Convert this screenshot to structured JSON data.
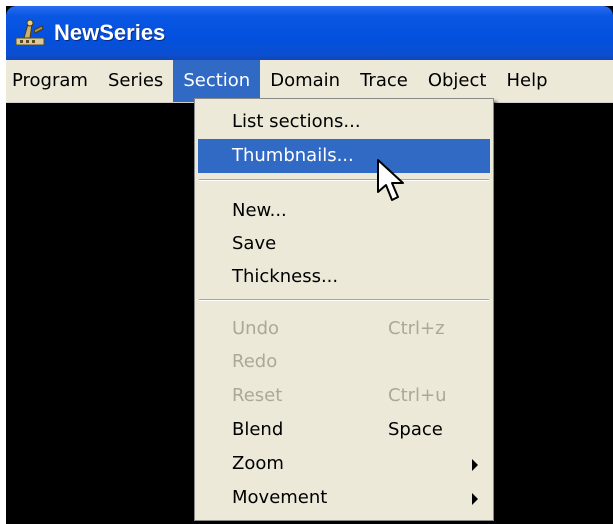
{
  "window": {
    "title": "NewSeries",
    "icon": "newseries-app-icon"
  },
  "menubar": {
    "items": [
      {
        "label": "Program"
      },
      {
        "label": "Series"
      },
      {
        "label": "Section",
        "active": true
      },
      {
        "label": "Domain"
      },
      {
        "label": "Trace"
      },
      {
        "label": "Object"
      },
      {
        "label": "Help"
      }
    ]
  },
  "section_menu": {
    "list_sections": "List sections...",
    "thumbnails": "Thumbnails...",
    "new": "New...",
    "save": "Save",
    "thickness": "Thickness...",
    "undo": "Undo",
    "undo_shortcut": "Ctrl+z",
    "redo": "Redo",
    "reset": "Reset",
    "reset_shortcut": "Ctrl+u",
    "blend": "Blend",
    "blend_shortcut": "Space",
    "zoom": "Zoom",
    "movement": "Movement"
  },
  "colors": {
    "highlight": "#316ac5",
    "menu_bg": "#ece9d8",
    "disabled_text": "#aca899",
    "titlebar": "#0a57e4"
  }
}
